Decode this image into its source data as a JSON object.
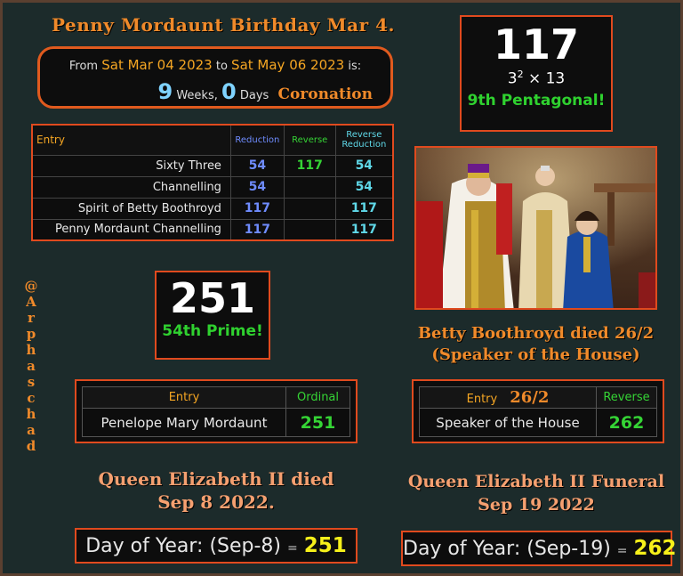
{
  "title": "Penny Mordaunt Birthday Mar 4.",
  "date_box": {
    "from_label": "From",
    "from_date": "Sat Mar 04 2023",
    "to_label": "to",
    "to_date": "Sat May 06 2023",
    "is_label": "is:",
    "weeks": "9",
    "weeks_label": "Weeks,",
    "days": "0",
    "days_label": "Days",
    "event": "Coronation"
  },
  "main_table": {
    "headers": [
      "Entry",
      "Reduction",
      "Reverse",
      "Reverse Reduction"
    ],
    "rows": [
      {
        "entry": "Sixty Three",
        "reduction": "54",
        "reverse": "117",
        "reverse_reduction": "54"
      },
      {
        "entry": "Channelling",
        "reduction": "54",
        "reverse": "",
        "reverse_reduction": "54"
      },
      {
        "entry": "Spirit of Betty Boothroyd",
        "reduction": "117",
        "reverse": "",
        "reverse_reduction": "117"
      },
      {
        "entry": "Penny Mordaunt Channelling",
        "reduction": "117",
        "reverse": "",
        "reverse_reduction": "117"
      }
    ]
  },
  "box_117": {
    "number": "117",
    "factor_base": "3",
    "factor_exp": "2",
    "factor_rest": " × 13",
    "note": "9th Pentagonal!"
  },
  "box_251": {
    "number": "251",
    "note": "54th Prime!"
  },
  "handle": "@Arphaschad",
  "betty_caption": {
    "line1": "Betty Boothroyd died 26/2",
    "line2": "(Speaker of the House)"
  },
  "penelope_table": {
    "headers": [
      "Entry",
      "Ordinal"
    ],
    "entry": "Penelope Mary Mordaunt",
    "value": "251"
  },
  "speaker_table": {
    "header_entry": "Entry",
    "header_date": "26/2",
    "header_value": "Reverse",
    "entry": "Speaker of the House",
    "value": "262"
  },
  "queen_death_caption": {
    "line1": "Queen Elizabeth II died",
    "line2": "Sep 8 2022."
  },
  "queen_funeral_caption": {
    "line1": "Queen Elizabeth II Funeral",
    "line2": "Sep 19 2022"
  },
  "doy_death": {
    "label": "Day of Year: (Sep-8)",
    "eq": "=",
    "value": "251"
  },
  "doy_funeral": {
    "label": "Day of Year: (Sep-19)",
    "eq": "=",
    "value": "262"
  },
  "colors": {
    "background": "#1c2b2b",
    "border_accent": "#e04a1e",
    "title_orange": "#f08a2a",
    "green": "#35d435",
    "blue": "#6f8cff",
    "cyan": "#5fd8e8",
    "yellow": "#f6f01a"
  }
}
